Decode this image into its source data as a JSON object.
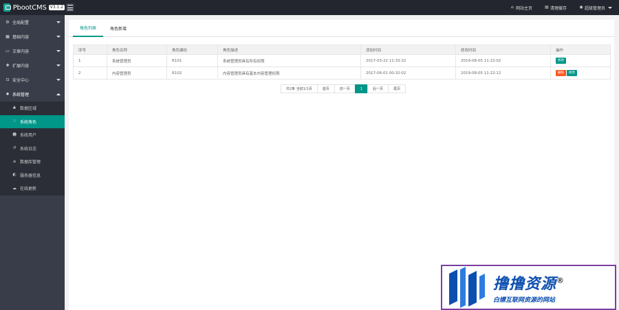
{
  "app": {
    "name": "PbootCMS",
    "version": "V3.1.2"
  },
  "header": {
    "site_home": "网站主页",
    "clear_cache": "清理缓存",
    "user": "超级管理员"
  },
  "sidebar": {
    "items": [
      {
        "label": "全局配置",
        "icon": "gear-icon"
      },
      {
        "label": "基础内容",
        "icon": "grid-icon"
      },
      {
        "label": "文章内容",
        "icon": "file-icon"
      },
      {
        "label": "扩展内容",
        "icon": "puzzle-icon"
      },
      {
        "label": "安全中心",
        "icon": "lock-icon"
      },
      {
        "label": "系统管理",
        "icon": "cog-icon"
      }
    ],
    "sub_items": [
      {
        "label": "数据区域",
        "icon": "sitemap-icon"
      },
      {
        "label": "系统角色",
        "icon": "hand-icon"
      },
      {
        "label": "系统用户",
        "icon": "users-icon"
      },
      {
        "label": "系统日志",
        "icon": "history-icon"
      },
      {
        "label": "数据库管理",
        "icon": "database-icon"
      },
      {
        "label": "服务器信息",
        "icon": "info-icon"
      },
      {
        "label": "在线更新",
        "icon": "cloud-icon"
      }
    ]
  },
  "tabs": [
    {
      "label": "角色列表"
    },
    {
      "label": "角色新增"
    }
  ],
  "table": {
    "headers": [
      "序号",
      "角色名称",
      "角色编码",
      "角色描述",
      "添加时间",
      "修改时间",
      "操作"
    ],
    "rows": [
      {
        "no": "1",
        "name": "系统管理员",
        "code": "R101",
        "desc": "系统管理员具有所有权限",
        "created": "2017-03-22 11:33:32",
        "updated": "2019-08-05 11:22:02",
        "edit": "修改"
      },
      {
        "no": "2",
        "name": "内容管理员",
        "code": "R102",
        "desc": "内容管理员具有基本内容管理权限",
        "created": "2017-06-01 00:32:02",
        "updated": "2019-08-05 11:22:12",
        "delete": "删除",
        "edit": "修改"
      }
    ]
  },
  "pager": {
    "info": "共2条 当前1/1页",
    "first": "首页",
    "prev": "前一页",
    "current": "1",
    "next": "后一页",
    "last": "尾页"
  },
  "watermark": {
    "title": "撸撸资源",
    "registered": "®",
    "subtitle": "白嫖互联网资源的网站"
  },
  "colors": {
    "accent": "#009688",
    "header_bg": "#23262e",
    "sidebar_bg": "#393d49",
    "danger": "#ff5722",
    "watermark_blue": "#0d4fb0"
  }
}
